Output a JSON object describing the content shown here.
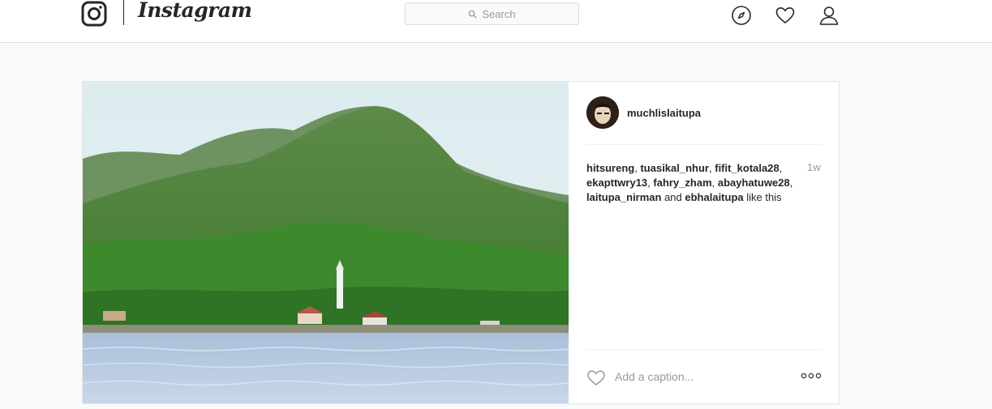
{
  "header": {
    "brand": "Instagram",
    "search_placeholder": "Search",
    "icons": [
      "instagram-logo-icon",
      "compass-icon",
      "heart-icon",
      "user-icon"
    ]
  },
  "post": {
    "username": "muchlislaitupa",
    "time_ago": "1w",
    "likers": [
      {
        "name": "hitsureng",
        "suffix": ", "
      },
      {
        "name": "tuasikal_nhur",
        "suffix": ", "
      },
      {
        "name": "fifit_kotala28",
        "suffix": ", "
      },
      {
        "name": "ekapttwry13",
        "suffix": ", "
      },
      {
        "name": "fahry_zham",
        "suffix": ", "
      },
      {
        "name": "abayhatuwe28",
        "suffix": ", "
      },
      {
        "name": "laitupa_nirman",
        "suffix": " and "
      },
      {
        "name": "ebhalaitupa",
        "suffix": ""
      }
    ],
    "likes_tail": " like this",
    "caption_placeholder": "Add a caption...",
    "more_label": "ooo"
  },
  "colors": {
    "text": "#262626",
    "muted": "#999999",
    "border": "#dbdbdb",
    "background": "#fafafa"
  }
}
